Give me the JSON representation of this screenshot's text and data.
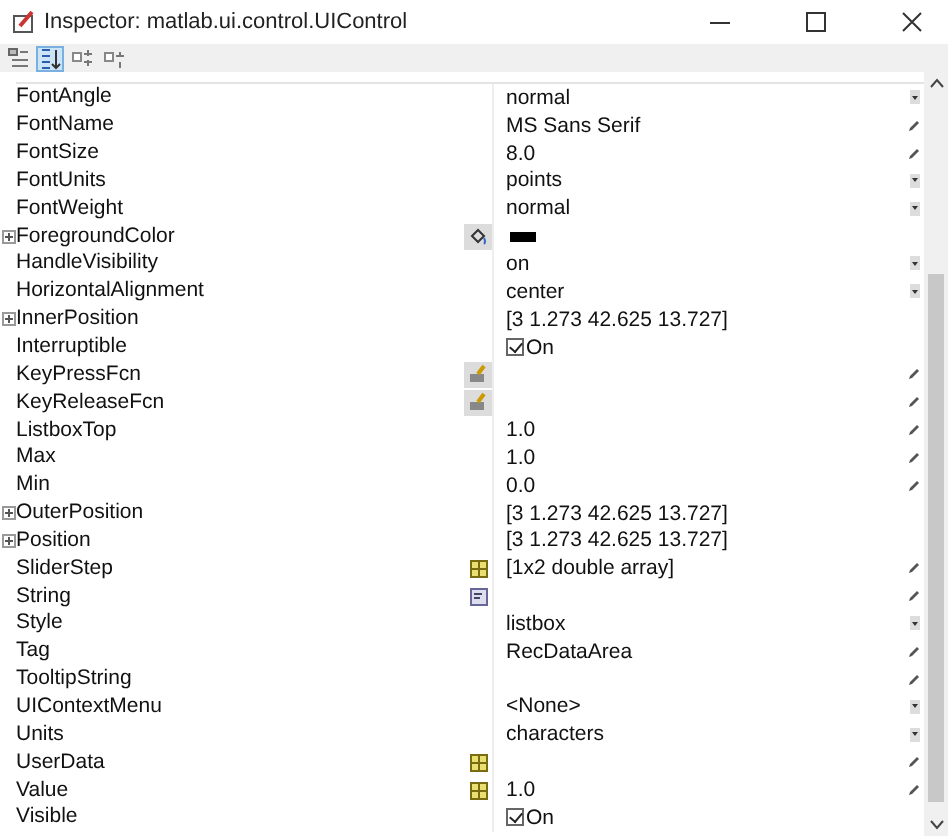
{
  "window": {
    "title": "Inspector:  matlab.ui.control.UIControl"
  },
  "toolbar": [
    {
      "kind": "categorize",
      "selected": false
    },
    {
      "kind": "sort",
      "selected": true
    },
    {
      "kind": "expand",
      "selected": false
    },
    {
      "kind": "collapse",
      "selected": false
    }
  ],
  "properties": [
    {
      "name": "FontAngle",
      "expandable": false,
      "kind": "text",
      "value": "normal",
      "control": {
        "kind": "dropdown"
      }
    },
    {
      "name": "FontName",
      "expandable": false,
      "kind": "text",
      "value": "MS Sans Serif",
      "control": {
        "kind": "pencil"
      }
    },
    {
      "name": "FontSize",
      "expandable": false,
      "kind": "text",
      "value": "8.0",
      "control": {
        "kind": "pencil"
      }
    },
    {
      "name": "FontUnits",
      "expandable": false,
      "kind": "text",
      "value": "points",
      "control": {
        "kind": "dropdown"
      }
    },
    {
      "name": "FontWeight",
      "expandable": false,
      "kind": "text",
      "value": "normal",
      "control": {
        "kind": "dropdown"
      }
    },
    {
      "name": "ForegroundColor",
      "expandable": true,
      "editor": {
        "kind": "color"
      },
      "kind": "color",
      "color": "#000000"
    },
    {
      "name": "HandleVisibility",
      "expandable": false,
      "kind": "text",
      "value": "on",
      "control": {
        "kind": "dropdown"
      }
    },
    {
      "name": "HorizontalAlignment",
      "expandable": false,
      "kind": "text",
      "value": "center",
      "control": {
        "kind": "dropdown"
      }
    },
    {
      "name": "InnerPosition",
      "expandable": true,
      "kind": "text",
      "value": "[3 1.273 42.625 13.727]"
    },
    {
      "name": "Interruptible",
      "expandable": false,
      "kind": "checkbox",
      "checked": true,
      "value": "On"
    },
    {
      "name": "KeyPressFcn",
      "expandable": false,
      "editor": {
        "kind": "callback"
      },
      "kind": "text",
      "control": {
        "kind": "pencil"
      }
    },
    {
      "name": "KeyReleaseFcn",
      "expandable": false,
      "editor": {
        "kind": "callback"
      },
      "kind": "text",
      "control": {
        "kind": "pencil"
      }
    },
    {
      "name": "ListboxTop",
      "expandable": false,
      "kind": "text",
      "value": "1.0",
      "control": {
        "kind": "pencil"
      }
    },
    {
      "name": "Max",
      "expandable": false,
      "kind": "text",
      "value": "1.0",
      "control": {
        "kind": "pencil"
      }
    },
    {
      "name": "Min",
      "expandable": false,
      "kind": "text",
      "value": "0.0",
      "control": {
        "kind": "pencil"
      }
    },
    {
      "name": "OuterPosition",
      "expandable": true,
      "kind": "text",
      "value": "[3 1.273 42.625 13.727]"
    },
    {
      "name": "Position",
      "expandable": true,
      "kind": "text",
      "value": "[3 1.273 42.625 13.727]"
    },
    {
      "name": "SliderStep",
      "expandable": false,
      "editor": {
        "kind": "matrix"
      },
      "kind": "text",
      "value": "[1x2  double array]",
      "control": {
        "kind": "pencil"
      }
    },
    {
      "name": "String",
      "expandable": false,
      "editor": {
        "kind": "string"
      },
      "kind": "text",
      "control": {
        "kind": "pencil"
      }
    },
    {
      "name": "Style",
      "expandable": false,
      "kind": "text",
      "value": "listbox",
      "control": {
        "kind": "dropdown"
      }
    },
    {
      "name": "Tag",
      "expandable": false,
      "kind": "text",
      "value": "RecDataArea",
      "control": {
        "kind": "pencil"
      }
    },
    {
      "name": "TooltipString",
      "expandable": false,
      "kind": "text",
      "control": {
        "kind": "pencil"
      }
    },
    {
      "name": "UIContextMenu",
      "expandable": false,
      "kind": "text",
      "value": "<None>",
      "control": {
        "kind": "dropdown"
      }
    },
    {
      "name": "Units",
      "expandable": false,
      "kind": "text",
      "value": "characters",
      "control": {
        "kind": "dropdown"
      }
    },
    {
      "name": "UserData",
      "expandable": false,
      "editor": {
        "kind": "matrix"
      },
      "kind": "text",
      "control": {
        "kind": "pencil"
      }
    },
    {
      "name": "Value",
      "expandable": false,
      "editor": {
        "kind": "matrix"
      },
      "kind": "text",
      "value": "1.0",
      "control": {
        "kind": "pencil"
      }
    },
    {
      "name": "Visible",
      "expandable": false,
      "kind": "checkbox",
      "checked": true,
      "value": "On"
    }
  ]
}
